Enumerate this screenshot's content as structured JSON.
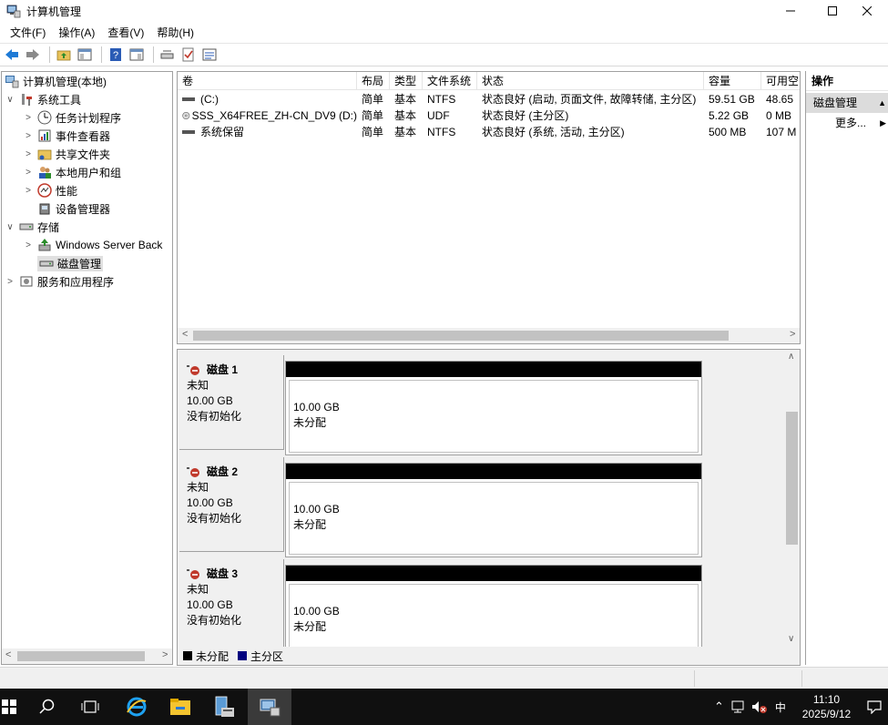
{
  "window": {
    "title": "计算机管理"
  },
  "menubar": [
    "文件(F)",
    "操作(A)",
    "查看(V)",
    "帮助(H)"
  ],
  "tree": {
    "root": "计算机管理(本地)",
    "system_tools": "系统工具",
    "items": [
      "任务计划程序",
      "事件查看器",
      "共享文件夹",
      "本地用户和组",
      "性能",
      "设备管理器"
    ],
    "storage": "存储",
    "storage_items": [
      "Windows Server Back",
      "磁盘管理"
    ],
    "services": "服务和应用程序"
  },
  "volume_table": {
    "columns": [
      "卷",
      "布局",
      "类型",
      "文件系统",
      "状态",
      "容量",
      "可用空"
    ],
    "rows": [
      {
        "name": "(C:)",
        "layout": "简单",
        "type": "基本",
        "fs": "NTFS",
        "status": "状态良好 (启动, 页面文件, 故障转储, 主分区)",
        "capacity": "59.51 GB",
        "free": "48.65"
      },
      {
        "name": "SSS_X64FREE_ZH-CN_DV9 (D:)",
        "layout": "简单",
        "type": "基本",
        "fs": "UDF",
        "status": "状态良好 (主分区)",
        "capacity": "5.22 GB",
        "free": "0 MB"
      },
      {
        "name": "系统保留",
        "layout": "简单",
        "type": "基本",
        "fs": "NTFS",
        "status": "状态良好 (系统, 活动, 主分区)",
        "capacity": "500 MB",
        "free": "107 M"
      }
    ]
  },
  "disks": [
    {
      "name": "磁盘 1",
      "kind": "未知",
      "size": "10.00 GB",
      "state": "没有初始化",
      "part_size": "10.00 GB",
      "part_state": "未分配"
    },
    {
      "name": "磁盘 2",
      "kind": "未知",
      "size": "10.00 GB",
      "state": "没有初始化",
      "part_size": "10.00 GB",
      "part_state": "未分配"
    },
    {
      "name": "磁盘 3",
      "kind": "未知",
      "size": "10.00 GB",
      "state": "没有初始化",
      "part_size": "10.00 GB",
      "part_state": "未分配"
    }
  ],
  "legend": {
    "unallocated": "未分配",
    "primary": "主分区",
    "unallocated_color": "#000000",
    "primary_color": "#00007f"
  },
  "actions": {
    "header": "操作",
    "section": "磁盘管理",
    "more": "更多..."
  },
  "taskbar": {
    "tray_lang": "中",
    "time": "11:10",
    "date": "2025/9/12"
  }
}
